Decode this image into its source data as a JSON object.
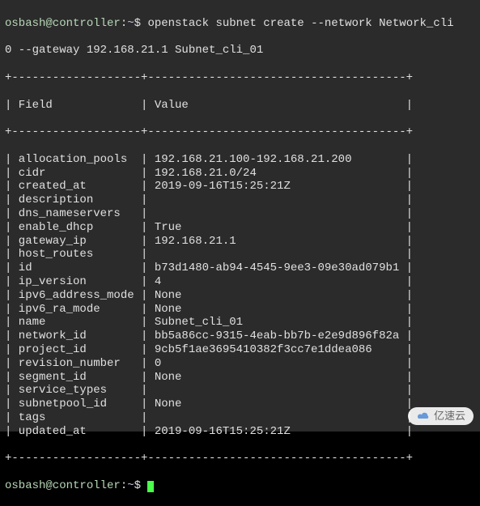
{
  "prompt1": {
    "user_host": "osbash@controller",
    "path": "~",
    "dollar": "$",
    "command_line1": "openstack subnet create --network Network_cli",
    "command_line2": "0 --gateway 192.168.21.1 Subnet_cli_01"
  },
  "table": {
    "border_top": "+-------------------+--------------------------------------+",
    "header_line": "| Field             | Value                                |",
    "border_mid": "+-------------------+--------------------------------------+",
    "rows": [
      {
        "field": "allocation_pools",
        "value": "192.168.21.100-192.168.21.200"
      },
      {
        "field": "cidr",
        "value": "192.168.21.0/24"
      },
      {
        "field": "created_at",
        "value": "2019-09-16T15:25:21Z"
      },
      {
        "field": "description",
        "value": ""
      },
      {
        "field": "dns_nameservers",
        "value": ""
      },
      {
        "field": "enable_dhcp",
        "value": "True"
      },
      {
        "field": "gateway_ip",
        "value": "192.168.21.1"
      },
      {
        "field": "host_routes",
        "value": ""
      },
      {
        "field": "id",
        "value": "b73d1480-ab94-4545-9ee3-09e30ad079b1"
      },
      {
        "field": "ip_version",
        "value": "4"
      },
      {
        "field": "ipv6_address_mode",
        "value": "None"
      },
      {
        "field": "ipv6_ra_mode",
        "value": "None"
      },
      {
        "field": "name",
        "value": "Subnet_cli_01"
      },
      {
        "field": "network_id",
        "value": "bb5a86cc-9315-4eab-bb7b-e2e9d896f82a"
      },
      {
        "field": "project_id",
        "value": "9cb5f1ae3695410382f3cc7e1ddea086"
      },
      {
        "field": "revision_number",
        "value": "0"
      },
      {
        "field": "segment_id",
        "value": "None"
      },
      {
        "field": "service_types",
        "value": ""
      },
      {
        "field": "subnetpool_id",
        "value": "None"
      },
      {
        "field": "tags",
        "value": ""
      },
      {
        "field": "updated_at",
        "value": "2019-09-16T15:25:21Z"
      }
    ],
    "border_bottom": "+-------------------+--------------------------------------+"
  },
  "prompt2": {
    "user_host": "osbash@controller",
    "path": "~",
    "dollar": "$"
  },
  "watermark_text": "亿速云"
}
